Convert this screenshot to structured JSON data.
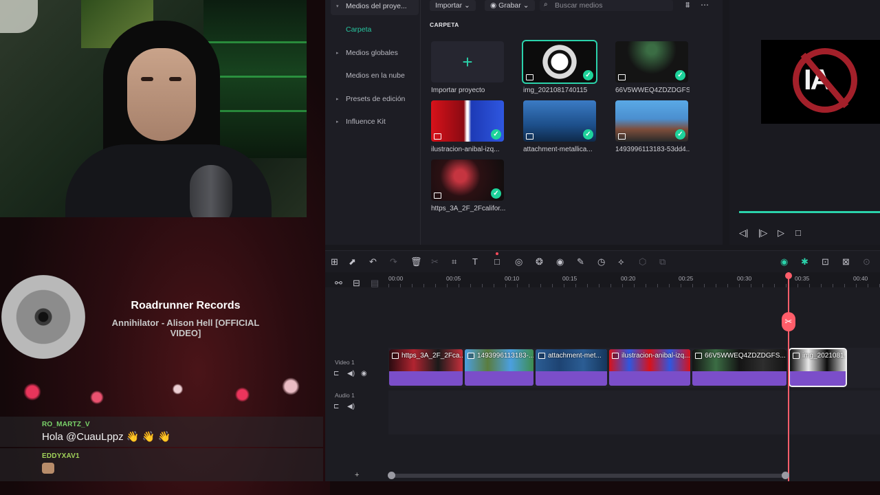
{
  "stream": {
    "music": {
      "title": "Roadrunner Records",
      "subtitle": "Annihilator - Alison Hell [OFFICIAL VIDEO]"
    },
    "chat": [
      {
        "user": "RO_MARTZ_V",
        "user_color": "#7ad36a",
        "text": "Hola @CuauLppz 👋 👋 👋"
      },
      {
        "user": "EDDYXAV1",
        "user_color": "#a2d35a",
        "text": ""
      }
    ]
  },
  "editor": {
    "sidebar": {
      "items": [
        {
          "label": "Medios del proye...",
          "caret": "▾"
        },
        {
          "label": "Carpeta",
          "caret": ""
        },
        {
          "label": "Medios globales",
          "caret": "▸"
        },
        {
          "label": "Medios en la nube",
          "caret": ""
        },
        {
          "label": "Presets de edición",
          "caret": "▸"
        },
        {
          "label": "Influence Kit",
          "caret": "▸"
        }
      ]
    },
    "toolbar": {
      "import_label": "Importar",
      "record_label": "Grabar",
      "search_placeholder": "Buscar medios"
    },
    "folder_label": "CARPETA",
    "media": [
      {
        "name": "Importar proyecto"
      },
      {
        "name": "img_2021081740115"
      },
      {
        "name": "66V5WWEQ4ZDZDGFS..."
      },
      {
        "name": "ilustracion-anibal-izq..."
      },
      {
        "name": "attachment-metallica..."
      },
      {
        "name": "1493996113183-53dd4..."
      },
      {
        "name": "https_3A_2F_2Fcalifor..."
      }
    ],
    "timeline": {
      "ticks": [
        "00:00",
        "00:05",
        "00:10",
        "00:15",
        "00:20",
        "00:25",
        "00:30",
        "00:35",
        "00:40"
      ],
      "tracks": {
        "video": "Video 1",
        "audio": "Audio 1"
      },
      "clips": [
        {
          "label": "https_3A_2F_2Fca..."
        },
        {
          "label": "1493996113183-..."
        },
        {
          "label": "attachment-met..."
        },
        {
          "label": "ilustracion-anibal-izq..."
        },
        {
          "label": "66V5WWEQ4ZDZDGFS..."
        },
        {
          "label": "img_2021081..."
        }
      ]
    },
    "colors": {
      "accent": "#2bd3ab",
      "playhead": "#ff5d6a",
      "clip": "#7b4ec9"
    }
  }
}
